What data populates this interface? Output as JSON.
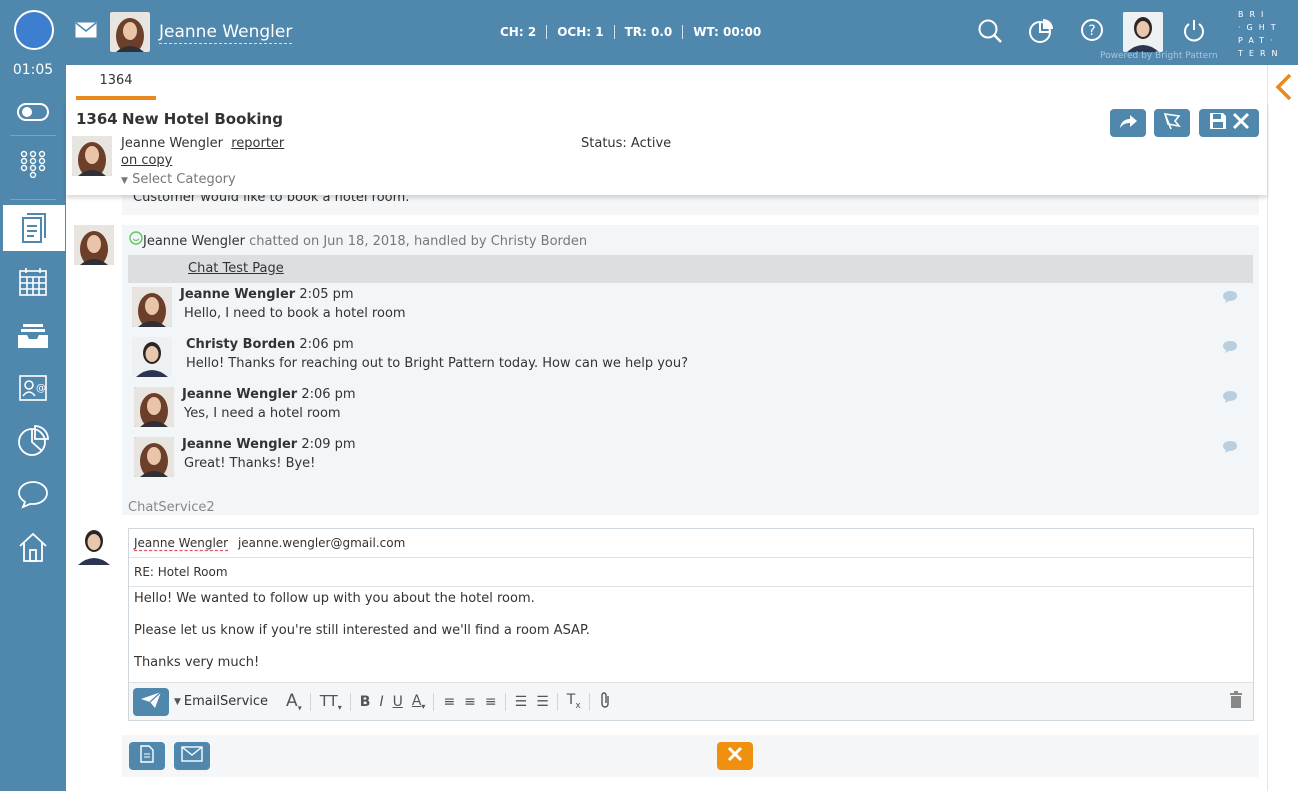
{
  "colors": {
    "brand_blue": "#4f87ad",
    "accent_orange": "#e8881f",
    "status_dot": "#3d7ecf"
  },
  "topbar": {
    "timer": "01:05",
    "contact_name": "Jeanne Wengler",
    "metrics": [
      "CH: 2",
      "OCH: 1",
      "TR: 0.0",
      "WT: 00:00"
    ],
    "brand_lines": [
      "BRI",
      "·GHT",
      "PAT·",
      "TERN"
    ],
    "powered_by": "Powered by Bright Pattern",
    "icons": [
      "search-icon",
      "stats-icon",
      "help-icon",
      "power-icon"
    ]
  },
  "nav": {
    "items": [
      "toggle-icon",
      "dialpad-icon",
      "cases-icon",
      "calendar-icon",
      "inbox-icon",
      "contacts-icon",
      "reports-icon",
      "chat-icon",
      "home-icon"
    ],
    "active": "cases-icon"
  },
  "tab": {
    "label": "1364"
  },
  "case": {
    "number": "1364",
    "title": "New Hotel Booking",
    "reporter_name": "Jeanne Wengler",
    "reporter_role": "reporter",
    "on_copy": "on copy",
    "select_category": "Select Category",
    "status": "Status: Active"
  },
  "feed": {
    "previous_note": "Customer would like to book a hotel room.",
    "chat": {
      "author": "Jeanne Wengler",
      "summary": " chatted on Jun 18, 2018, handled by Christy Borden",
      "page": "Chat Test Page",
      "messages": [
        {
          "name": "Jeanne Wengler",
          "time": "2:05 pm",
          "text": "Hello, I need to book a hotel room"
        },
        {
          "name": "Christy Borden",
          "time": "2:06 pm",
          "text": "Hello! Thanks for reaching out to Bright Pattern today. How can we help you?"
        },
        {
          "name": "Jeanne Wengler",
          "time": "2:06 pm",
          "text": "Yes, I need a hotel room"
        },
        {
          "name": "Jeanne Wengler",
          "time": "2:09 pm",
          "text": "Great! Thanks! Bye!"
        }
      ],
      "service": "ChatService2"
    },
    "email": {
      "to_name": "Jeanne Wengler",
      "to_address": "jeanne.wengler@gmail.com",
      "subject": "RE: Hotel Room",
      "body": [
        "Hello! We wanted to follow up with you about the hotel room.",
        "Please let us know if you're still interested and we'll find a room ASAP.",
        "Thanks very much!"
      ],
      "service": "EmailService"
    }
  }
}
